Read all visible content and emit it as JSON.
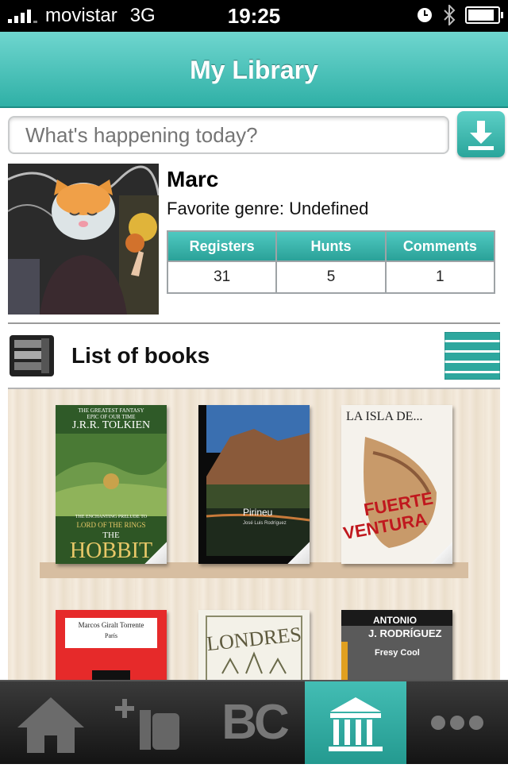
{
  "status_bar": {
    "carrier": "movistar",
    "network": "3G",
    "time": "19:25"
  },
  "nav": {
    "title": "My Library"
  },
  "post": {
    "placeholder": "What's happening today?"
  },
  "profile": {
    "name": "Marc",
    "favorite_genre": "Favorite genre: Undefined",
    "stats": {
      "headers": [
        "Registers",
        "Hunts",
        "Comments"
      ],
      "values": [
        "31",
        "5",
        "1"
      ]
    }
  },
  "books_section": {
    "title": "List of books"
  },
  "books": [
    {
      "name": "The Hobbit",
      "lines": [
        "THE GREATEST FANTASY",
        "EPIC OF OUR TIME",
        "J.R.R. TOLKIEN",
        "THE ENCHANTING PRELUDE TO",
        "LORD OF THE RINGS",
        "THE",
        "HOBBIT"
      ]
    },
    {
      "name": "Pirineu",
      "lines": [
        "Pirineu",
        "José Luis Rodríguez"
      ]
    },
    {
      "name": "La isla de... Fuerteventura",
      "lines": [
        "LA ISLA DE...",
        "FUERTE",
        "VENTURA"
      ]
    },
    {
      "name": "Paris",
      "lines": [
        "Marcos Giralt Torrente",
        "París"
      ]
    },
    {
      "name": "Londres",
      "lines": [
        "LONDRES"
      ]
    },
    {
      "name": "Fresy Cool",
      "lines": [
        "ANTONIO",
        "J. RODRÍGUEZ",
        "Fresy Cool"
      ]
    }
  ],
  "tabs": [
    {
      "icon": "home-icon",
      "label": ""
    },
    {
      "icon": "add-book-icon",
      "label": ""
    },
    {
      "icon": "bc-logo-icon",
      "label": "BC"
    },
    {
      "icon": "library-icon",
      "label": "",
      "active": true
    },
    {
      "icon": "more-icon",
      "label": ""
    }
  ],
  "colors": {
    "accent": "#2fb0a6",
    "tab_active": "#2ea79e"
  }
}
